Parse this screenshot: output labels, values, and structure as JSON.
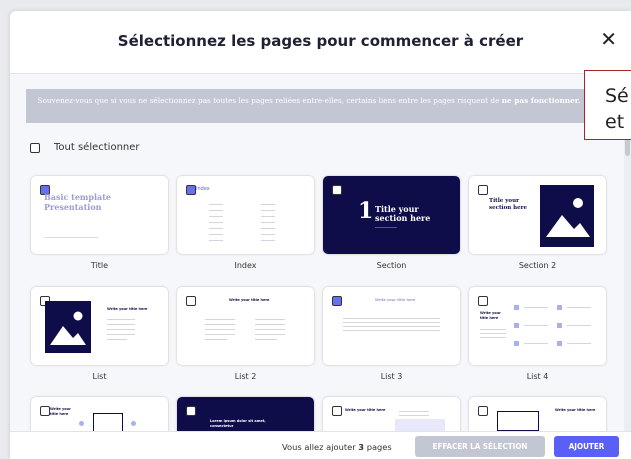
{
  "modal": {
    "title": "Sélectionnez les pages pour commencer à créer",
    "close_icon": "close-icon",
    "notice": "Souvenez-vous que si vous ne sélectionnez pas toutes les pages reliées entre-elles, certains liens entre les pages risquent de",
    "notice_bold": "ne pas fonctionner",
    "notice_end": ".",
    "select_all": {
      "label": "Tout sélectionner",
      "checked": false
    },
    "pages": [
      {
        "caption": "Title",
        "checked": true,
        "thumb_text": "Basic template Presentation"
      },
      {
        "caption": "Index",
        "checked": true,
        "thumb_text": "Index"
      },
      {
        "caption": "Section",
        "checked": false,
        "thumb_num": "1",
        "thumb_text": "Title your section here"
      },
      {
        "caption": "Section 2",
        "checked": false,
        "thumb_text": "Title your section here"
      },
      {
        "caption": "List",
        "checked": false,
        "thumb_text": "Write your title here"
      },
      {
        "caption": "List 2",
        "checked": false,
        "thumb_text": "Write your title here"
      },
      {
        "caption": "List 3",
        "checked": true,
        "thumb_text": "Write your title here"
      },
      {
        "caption": "List 4",
        "checked": false,
        "thumb_text": "Write your title here"
      },
      {
        "caption": "",
        "checked": false,
        "thumb_text": "Write your title here"
      },
      {
        "caption": "",
        "checked": false,
        "thumb_text": "Lorem ipsum dolor sit amet, consectetur"
      },
      {
        "caption": "",
        "checked": false,
        "thumb_text": "Write your title here"
      },
      {
        "caption": "",
        "checked": false,
        "thumb_text": "Write your title here"
      }
    ],
    "footer": {
      "info_prefix": "Vous allez ajouter",
      "count": "3",
      "info_suffix": "pages",
      "clear_label": "EFFACER LA SÉLECTION",
      "add_label": "AJOUTER"
    }
  },
  "tooltip": {
    "line1": "Sé",
    "line2": "et"
  },
  "colors": {
    "accent": "#5a5ff5",
    "checked": "#6a6ff0",
    "notice_bg": "#c3c6d3",
    "dark_slide": "#0e0d4a",
    "tooltip_border": "#a3262a"
  }
}
